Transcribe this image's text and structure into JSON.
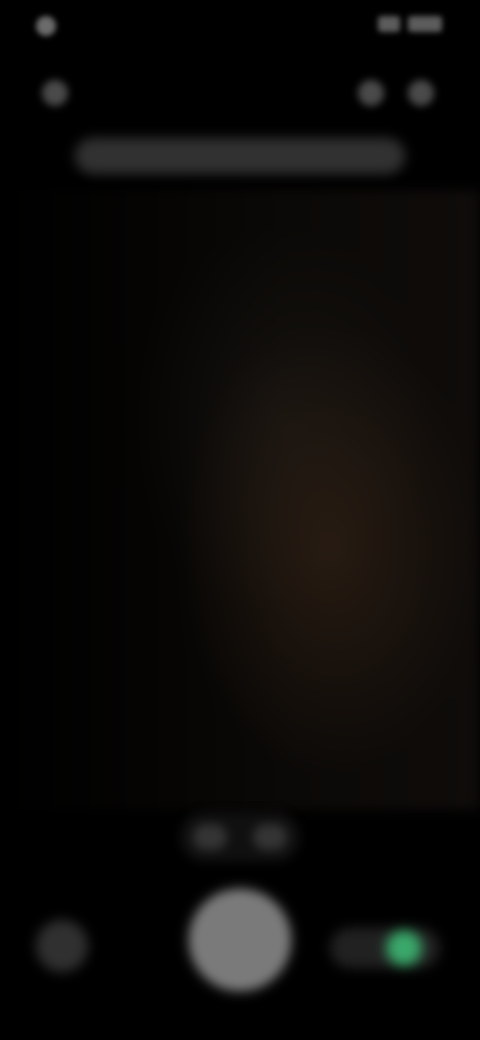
{
  "status_bar": {
    "left_text": "",
    "right_text": ""
  },
  "top_controls": {
    "flash": "flash-icon",
    "hdr": "hdr-icon",
    "settings": "settings-icon"
  },
  "info_strip": {
    "text": ""
  },
  "zoom": {
    "options": [
      "",
      ""
    ]
  },
  "bottom": {
    "gallery": "gallery-thumbnail",
    "shutter": "shutter-button",
    "switch": "camera-switch-toggle"
  },
  "colors": {
    "background": "#000000",
    "shutter": "#7a7a7a",
    "accent": "#3aa86a"
  }
}
